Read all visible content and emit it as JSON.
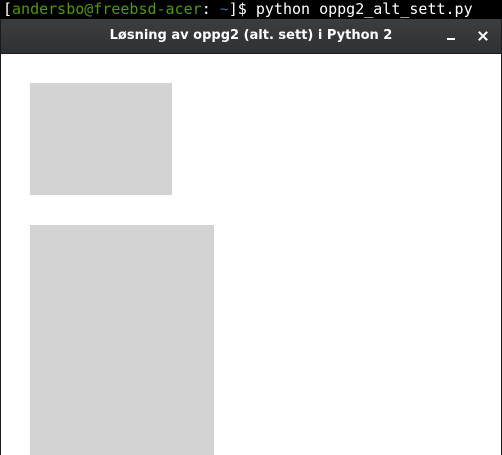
{
  "terminal": {
    "open_bracket": "[",
    "user_host": "andersbo@freebsd-acer",
    "colon": ":",
    "path": " ~",
    "prompt_end": "]$ ",
    "command": "python oppg2_alt_sett.py"
  },
  "window": {
    "title": "Løsning av oppg2 (alt. sett) i Python 2",
    "minimize_icon": "minimize-icon",
    "close_icon": "close-icon"
  },
  "canvas": {
    "rect_color": "#d3d3d3",
    "background": "#ffffff"
  }
}
